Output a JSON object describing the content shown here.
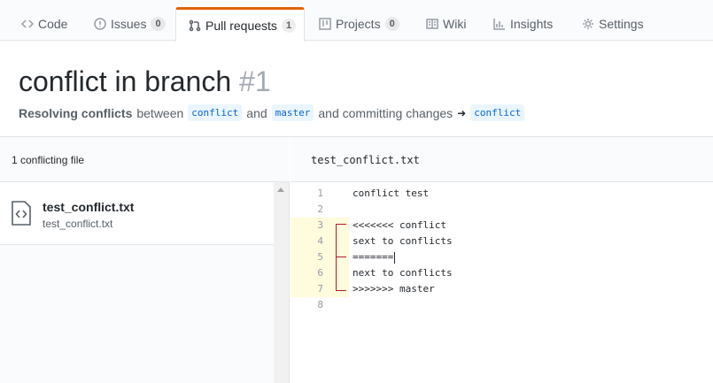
{
  "tabs": [
    {
      "label": "Code",
      "icon": "code-icon"
    },
    {
      "label": "Issues",
      "count": "0",
      "icon": "issue-icon"
    },
    {
      "label": "Pull requests",
      "count": "1",
      "icon": "pull-request-icon",
      "selected": true
    },
    {
      "label": "Projects",
      "count": "0",
      "icon": "project-icon"
    },
    {
      "label": "Wiki",
      "icon": "book-icon"
    },
    {
      "label": "Insights",
      "icon": "graph-icon"
    },
    {
      "label": "Settings",
      "icon": "gear-icon"
    }
  ],
  "header": {
    "title": "conflict in branch",
    "number": "#1",
    "resolving": "Resolving conflicts",
    "between": "between",
    "branch_head": "conflict",
    "and": "and",
    "branch_base": "master",
    "committing": "and committing changes",
    "branch_target": "conflict"
  },
  "sidebar": {
    "summary": "1 conflicting file",
    "files": [
      {
        "name": "test_conflict.txt",
        "path": "test_conflict.txt"
      }
    ]
  },
  "editor": {
    "filename": "test_conflict.txt",
    "lines": [
      {
        "n": "1",
        "text": "conflict test"
      },
      {
        "n": "2",
        "text": ""
      },
      {
        "n": "3",
        "text": "<<<<<<< conflict"
      },
      {
        "n": "4",
        "text": "sext to conflicts"
      },
      {
        "n": "5",
        "text": "======="
      },
      {
        "n": "6",
        "text": "next to conflicts"
      },
      {
        "n": "7",
        "text": ">>>>>>> master"
      },
      {
        "n": "8",
        "text": ""
      }
    ]
  },
  "colors": {
    "accent": "#e36209",
    "conflict_bg": "#fffbdd",
    "marker": "#b31d28",
    "branch_bg": "#eaf5ff",
    "branch_text": "#0366d6"
  }
}
